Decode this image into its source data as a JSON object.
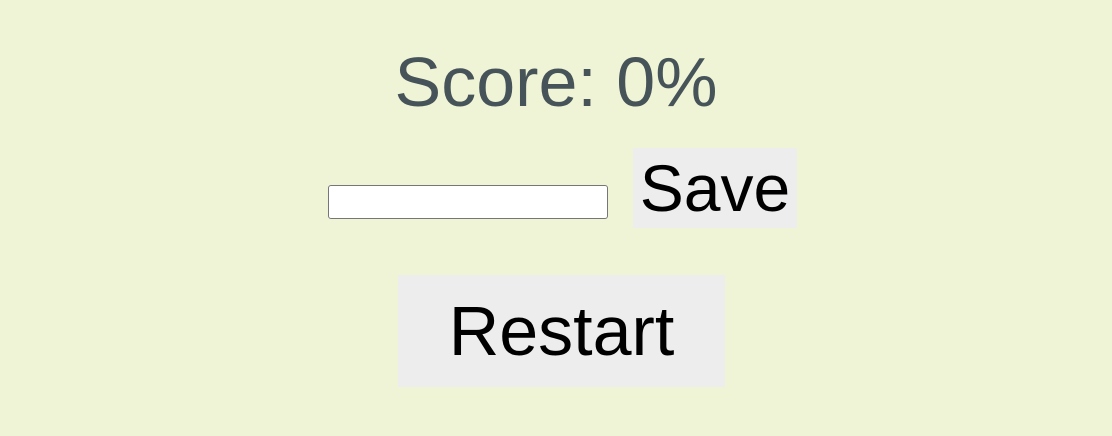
{
  "score": {
    "text": "Score: 0%"
  },
  "save_form": {
    "name_value": "",
    "name_placeholder": "",
    "save_label": "Save"
  },
  "controls": {
    "restart_label": "Restart"
  },
  "colors": {
    "background": "#f0f4d6",
    "score_text": "#465358",
    "button_background": "#ededed"
  }
}
